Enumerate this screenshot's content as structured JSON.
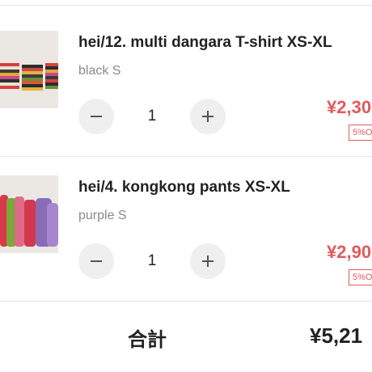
{
  "cart": {
    "items": [
      {
        "name": "hei/12. multi dangara T-shirt XS-XL",
        "variant": "black S",
        "quantity": "1",
        "price": "¥2,30",
        "discount": "5%O"
      },
      {
        "name": "hei/4. kongkong pants XS-XL",
        "variant": "purple S",
        "quantity": "1",
        "price": "¥2,90",
        "discount": "5%O"
      }
    ],
    "total_label": "合計",
    "total_value": "¥5,21"
  },
  "colors": {
    "price": "#e35a5a",
    "divider": "#e6e6e6",
    "qty_button_bg": "#efefef"
  },
  "icons": {
    "decrease": "minus-icon",
    "increase": "plus-icon"
  }
}
